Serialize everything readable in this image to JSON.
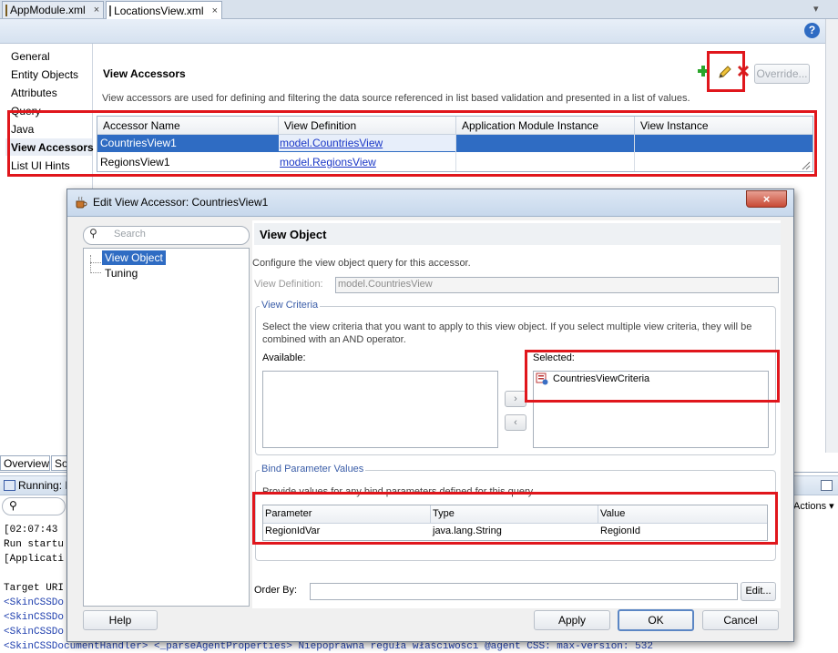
{
  "editor_tabs": [
    {
      "label": "AppModule.xml"
    },
    {
      "label": "LocationsView.xml"
    }
  ],
  "tabs_close_glyph": "×",
  "help_label": "?",
  "nav": {
    "items": [
      "General",
      "Entity Objects",
      "Attributes",
      "Query",
      "Java",
      "View Accessors",
      "List UI Hints"
    ],
    "selected": "View Accessors"
  },
  "section": {
    "title": "View Accessors",
    "description": "View accessors are used for defining and filtering the data source referenced in list based validation and presented in a list of values.",
    "override_label": "Override..."
  },
  "accessors_table": {
    "columns": [
      "Accessor Name",
      "View Definition",
      "Application Module Instance",
      "View Instance"
    ],
    "rows": [
      {
        "name": "CountriesView1",
        "definition": "model.CountriesView",
        "am_instance": "",
        "view_instance": ""
      },
      {
        "name": "RegionsView1",
        "definition": "model.RegionsView",
        "am_instance": "",
        "view_instance": ""
      }
    ],
    "selected_color": "#2f6cc3"
  },
  "bottom": {
    "tabs": [
      "Overview",
      "So"
    ],
    "running_label": "Running: I",
    "actions_label": "Actions ▾",
    "log_lines": [
      {
        "text": "[02:07:43",
        "blue": false
      },
      {
        "text": "Run startu",
        "blue": false
      },
      {
        "text": "[Applicati",
        "blue": false
      },
      {
        "text": "",
        "blue": false
      },
      {
        "text": "Target URI",
        "blue": false
      },
      {
        "text": "<SkinCSSDo",
        "blue": true
      },
      {
        "text": "<SkinCSSDo",
        "blue": true
      },
      {
        "text": "<SkinCSSDo",
        "blue": true
      },
      {
        "text": "<SkinCSSDocumentHandler> <_parseAgentProperties> Niepoprawna reguła właściwości @agent CSS: max-version: 532",
        "blue": true
      }
    ]
  },
  "dialog": {
    "title": "Edit View Accessor: CountriesView1",
    "close_label": "×",
    "search_placeholder": "Search",
    "tree": [
      "View Object",
      "Tuning"
    ],
    "panel_title": "View Object",
    "panel_desc": "Configure the view object query for this accessor.",
    "view_def_label": "View Definition:",
    "view_def_value": "model.CountriesView",
    "criteria_group": "View Criteria",
    "criteria_desc_1": "Select the view criteria that you want to apply to this view object. If you select multiple view criteria, they will be",
    "criteria_desc_2": "combined with an AND operator.",
    "available_label": "Available:",
    "selected_label": "Selected:",
    "selected_items": [
      "CountriesViewCriteria"
    ],
    "move_right": "›",
    "move_left": "‹",
    "bind_group": "Bind Parameter Values",
    "bind_desc": "Provide values for any bind parameters defined for this query",
    "bind_columns": [
      "Parameter",
      "Type",
      "Value"
    ],
    "bind_rows": [
      {
        "parameter": "RegionIdVar",
        "type": "java.lang.String",
        "value": "RegionId"
      }
    ],
    "order_by_label": "Order By:",
    "edit_label": "Edit...",
    "help_btn": "Help",
    "apply_btn": "Apply",
    "ok_btn": "OK",
    "cancel_btn": "Cancel"
  },
  "colors": {
    "highlight_red": "#e0161c",
    "add_green": "#2ba52b",
    "delete_red": "#d42020",
    "link_blue": "#1a37c7"
  }
}
